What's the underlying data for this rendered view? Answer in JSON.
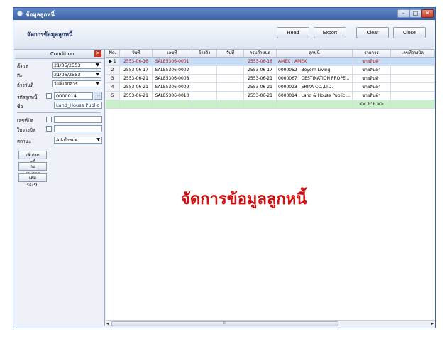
{
  "window": {
    "title": "ข้อมูลลูกหนี้",
    "min_glyph": "–",
    "max_glyph": "□",
    "close_glyph": "✕"
  },
  "header": {
    "title": "จัดการข้อมูลลูกหนี้"
  },
  "toolbar": {
    "read_label": "Read",
    "export_label": "Export",
    "clear_label": "Clear",
    "close_label": "Close"
  },
  "condition": {
    "title": "Condition",
    "close_glyph": "✕",
    "start_label": "ตั้งแต่",
    "start_value": "21/05/2553",
    "to_label": "ถึง",
    "to_value": "21/06/2553",
    "datetype_label": "อ้างวันที่",
    "datetype_value": "วันที่เอกสาร",
    "debtor_code_label": "รหัสลูกหนี้",
    "debtor_code_value": "0000014",
    "name_label": "ชื่อ",
    "name_value": "Land_House Public Comp",
    "bill_label": "เลขที่บิล",
    "invoice_label": "ใบวางบิล",
    "status_label": "สถานะ",
    "status_value": "All-ทั้งหมด",
    "btn_add_debtor": "เพิ่ม/ลดหนี้",
    "btn_edit": "ลบรายการ",
    "btn_add_money": "เพิ่มรองรับ"
  },
  "grid": {
    "columns": [
      "No.",
      "วันที่",
      "เลขที่",
      "อ้างอิง",
      "วันที่",
      "ครบกำหนด",
      "ลูกหนี้",
      "รายการ",
      "เลขที่วางบิล"
    ],
    "rows": [
      {
        "no": "1",
        "date": "2553-06-16",
        "doc": "SALE5306-0001",
        "ref": "",
        "date2": "",
        "due": "2553-06-16",
        "debtor": "AMEX : AMEX",
        "item": "ขายสินค้า",
        "billno": ""
      },
      {
        "no": "2",
        "date": "2553-06-17",
        "doc": "SALE5306-0002",
        "ref": "",
        "date2": "",
        "due": "2553-06-17",
        "debtor": "0000052 : Beyorn Living",
        "item": "ขายสินค้า",
        "billno": ""
      },
      {
        "no": "3",
        "date": "2553-06-21",
        "doc": "SALE5306-0008",
        "ref": "",
        "date2": "",
        "due": "2553-06-21",
        "debtor": "0000067 : DESTINATION PROPE...",
        "item": "ขายสินค้า",
        "billno": ""
      },
      {
        "no": "4",
        "date": "2553-06-21",
        "doc": "SALE5306-0009",
        "ref": "",
        "date2": "",
        "due": "2553-06-21",
        "debtor": "0000023 : ERIKA CO.,LTD.",
        "item": "ขายสินค้า",
        "billno": ""
      },
      {
        "no": "5",
        "date": "2553-06-21",
        "doc": "SALE5306-0010",
        "ref": "",
        "date2": "",
        "due": "2553-06-21",
        "debtor": "0000014 : Land & House Public ...",
        "item": "ขายสินค้า",
        "billno": ""
      }
    ],
    "new_row_label": "<< ขาย >>",
    "current_row_marker": "▶"
  },
  "watermark": "จัดการข้อมูลลูกหนี้",
  "scrollbar": {
    "thumb_glyph": "III",
    "left_glyph": "◂",
    "right_glyph": "▸"
  },
  "colors": {
    "titlebar": "#4a72b5",
    "selected_row": "#c7dcf5",
    "new_row": "#c9f0c9",
    "watermark": "#d01010"
  }
}
